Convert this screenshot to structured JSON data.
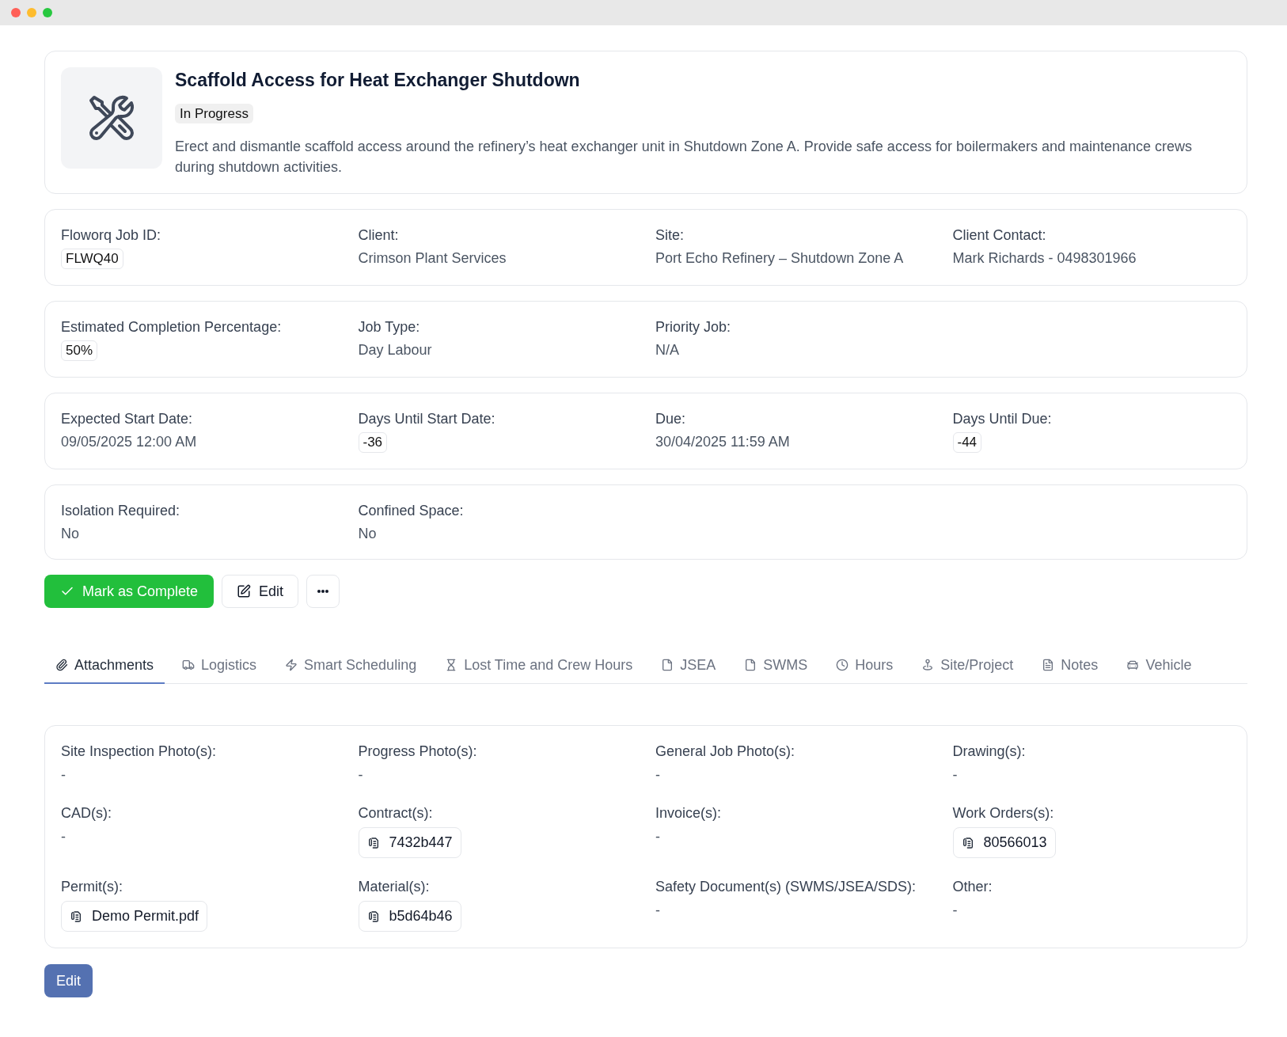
{
  "job": {
    "title": "Scaffold Access for Heat Exchanger Shutdown",
    "status": "In Progress",
    "description": "Erect and dismantle scaffold access around the refinery’s heat exchanger unit in Shutdown Zone A. Provide safe access for boilermakers and maintenance crews during shutdown activities."
  },
  "detail_cards": [
    {
      "fields": [
        {
          "label": "Floworq Job ID:",
          "value": "FLWQ40",
          "kind": "tag"
        },
        {
          "label": "Client:",
          "value": "Crimson Plant Services",
          "kind": "text"
        },
        {
          "label": "Site:",
          "value": "Port Echo Refinery – Shutdown Zone A",
          "kind": "text"
        },
        {
          "label": "Client Contact:",
          "value": "Mark Richards - 0498301966",
          "kind": "text"
        }
      ]
    },
    {
      "fields": [
        {
          "label": "Estimated Completion Percentage:",
          "value": "50%",
          "kind": "tag"
        },
        {
          "label": "Job Type:",
          "value": "Day Labour",
          "kind": "text"
        },
        {
          "label": "Priority Job:",
          "value": "N/A",
          "kind": "text"
        }
      ]
    },
    {
      "fields": [
        {
          "label": "Expected Start Date:",
          "value": "09/05/2025 12:00 AM",
          "kind": "text"
        },
        {
          "label": "Days Until Start Date:",
          "value": "-36",
          "kind": "tag"
        },
        {
          "label": "Due:",
          "value": "30/04/2025 11:59 AM",
          "kind": "text"
        },
        {
          "label": "Days Until Due:",
          "value": "-44",
          "kind": "tag"
        }
      ]
    },
    {
      "fields": [
        {
          "label": "Isolation Required:",
          "value": "No",
          "kind": "text"
        },
        {
          "label": "Confined Space:",
          "value": "No",
          "kind": "text"
        }
      ]
    }
  ],
  "actions": [
    {
      "kind": "complete",
      "label": "Mark as Complete"
    },
    {
      "kind": "edit",
      "label": "Edit"
    },
    {
      "kind": "more"
    }
  ],
  "tabs": [
    {
      "label": "Attachments",
      "selected": true
    },
    {
      "label": "Logistics",
      "selected": false
    },
    {
      "label": "Smart Scheduling",
      "selected": false
    },
    {
      "label": "Lost Time and Crew Hours",
      "selected": false
    },
    {
      "label": "JSEA",
      "selected": false
    },
    {
      "label": "SWMS",
      "selected": false
    },
    {
      "label": "Hours",
      "selected": false
    },
    {
      "label": "Site/Project",
      "selected": false
    },
    {
      "label": "Notes",
      "selected": false
    },
    {
      "label": "Vehicle",
      "selected": false
    }
  ],
  "attachments": {
    "fields": [
      {
        "label": "Site Inspection Photo(s):",
        "kind": "empty",
        "value": "-"
      },
      {
        "label": "Progress Photo(s):",
        "kind": "empty",
        "value": "-"
      },
      {
        "label": "General Job Photo(s):",
        "kind": "empty",
        "value": "-"
      },
      {
        "label": "Drawing(s):",
        "kind": "empty",
        "value": "-"
      },
      {
        "label": "CAD(s):",
        "kind": "empty",
        "value": "-"
      },
      {
        "label": "Contract(s):",
        "kind": "files",
        "files": [
          "7432b447"
        ]
      },
      {
        "label": "Invoice(s):",
        "kind": "empty",
        "value": "-"
      },
      {
        "label": "Work Orders(s):",
        "kind": "files",
        "files": [
          "80566013"
        ]
      },
      {
        "label": "Permit(s):",
        "kind": "files",
        "files": [
          "Demo Permit.pdf"
        ]
      },
      {
        "label": "Material(s):",
        "kind": "files",
        "files": [
          "b5d64b46"
        ]
      },
      {
        "label": "Safety Document(s) (SWMS/JSEA/SDS):",
        "kind": "empty",
        "value": "-"
      },
      {
        "label": "Other:",
        "kind": "empty",
        "value": "-"
      }
    ]
  },
  "footer_button": {
    "label": "Edit"
  }
}
